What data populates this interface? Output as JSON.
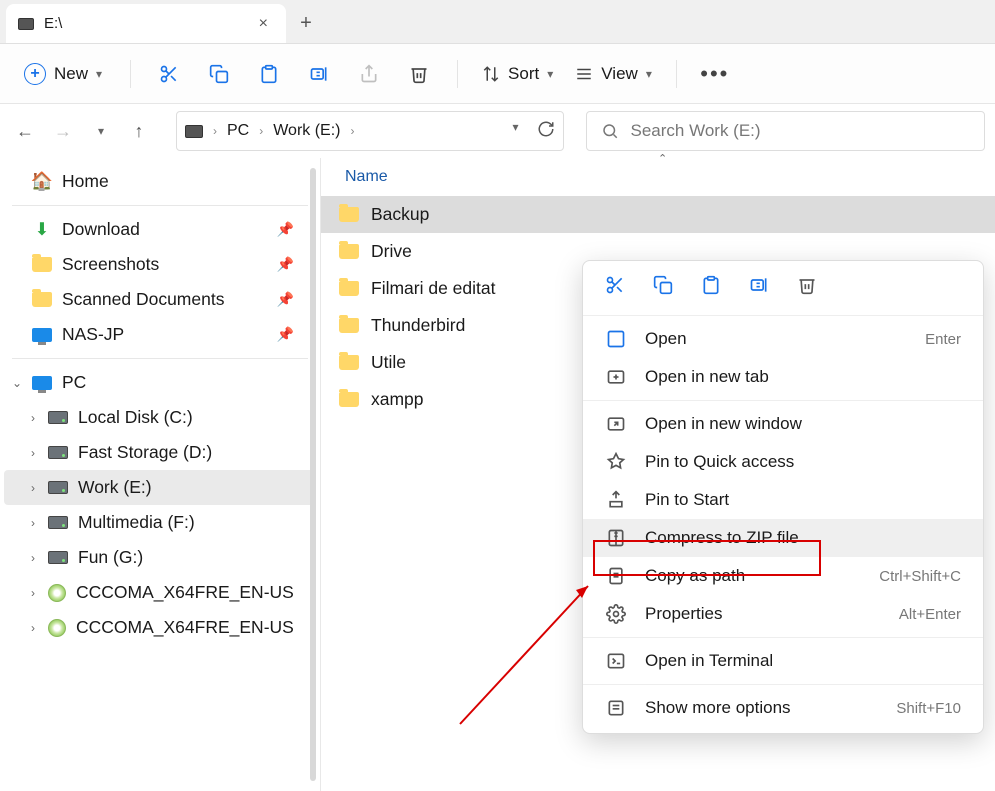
{
  "tab": {
    "title": "E:\\",
    "new_tab": "+"
  },
  "toolbar": {
    "new_label": "New",
    "sort_label": "Sort",
    "view_label": "View"
  },
  "nav": {
    "crumbs": [
      "PC",
      "Work (E:)"
    ],
    "search_placeholder": "Search Work (E:)"
  },
  "sidebar": {
    "home": "Home",
    "quick": [
      {
        "label": "Download",
        "icon": "download"
      },
      {
        "label": "Screenshots",
        "icon": "folder"
      },
      {
        "label": "Scanned Documents",
        "icon": "folder"
      },
      {
        "label": "NAS-JP",
        "icon": "monitor"
      }
    ],
    "pc_label": "PC",
    "drives": [
      {
        "label": "Local Disk (C:)",
        "icon": "drive"
      },
      {
        "label": "Fast Storage (D:)",
        "icon": "drive"
      },
      {
        "label": "Work (E:)",
        "icon": "drive",
        "selected": true
      },
      {
        "label": "Multimedia (F:)",
        "icon": "drive"
      },
      {
        "label": "Fun (G:)",
        "icon": "drive"
      },
      {
        "label": "CCCOMA_X64FRE_EN-US",
        "icon": "dvd"
      },
      {
        "label": "CCCOMA_X64FRE_EN-US",
        "icon": "dvd"
      }
    ]
  },
  "columns": {
    "name": "Name"
  },
  "files": [
    {
      "name": "Backup",
      "selected": true
    },
    {
      "name": "Drive"
    },
    {
      "name": "Filmari de editat"
    },
    {
      "name": "Thunderbird"
    },
    {
      "name": "Utile"
    },
    {
      "name": "xampp"
    }
  ],
  "context_menu": {
    "items": [
      {
        "label": "Open",
        "shortcut": "Enter",
        "icon": "open"
      },
      {
        "label": "Open in new tab",
        "icon": "newtab"
      },
      {
        "label": "Open in new window",
        "icon": "newwin"
      },
      {
        "label": "Pin to Quick access",
        "icon": "pin"
      },
      {
        "label": "Pin to Start",
        "icon": "pin"
      },
      {
        "label": "Compress to ZIP file",
        "icon": "zip",
        "highlighted": true
      },
      {
        "label": "Copy as path",
        "shortcut": "Ctrl+Shift+C",
        "icon": "copypath"
      },
      {
        "label": "Properties",
        "shortcut": "Alt+Enter",
        "icon": "props"
      },
      {
        "label": "Open in Terminal",
        "icon": "terminal"
      },
      {
        "label": "Show more options",
        "shortcut": "Shift+F10",
        "icon": "more"
      }
    ]
  }
}
